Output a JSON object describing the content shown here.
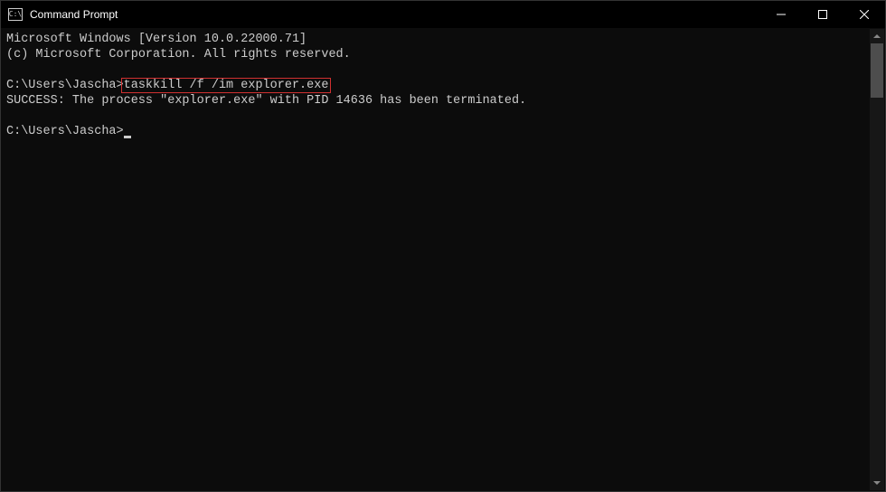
{
  "window": {
    "title": "Command Prompt",
    "icon_label": "cmd-icon"
  },
  "terminal": {
    "line1": "Microsoft Windows [Version 10.0.22000.71]",
    "line2": "(c) Microsoft Corporation. All rights reserved.",
    "prompt1_prefix": "C:\\Users\\Jascha>",
    "command1": "taskkill /f /im explorer.exe",
    "output1": "SUCCESS: The process \"explorer.exe\" with PID 14636 has been terminated.",
    "prompt2_prefix": "C:\\Users\\Jascha>"
  }
}
